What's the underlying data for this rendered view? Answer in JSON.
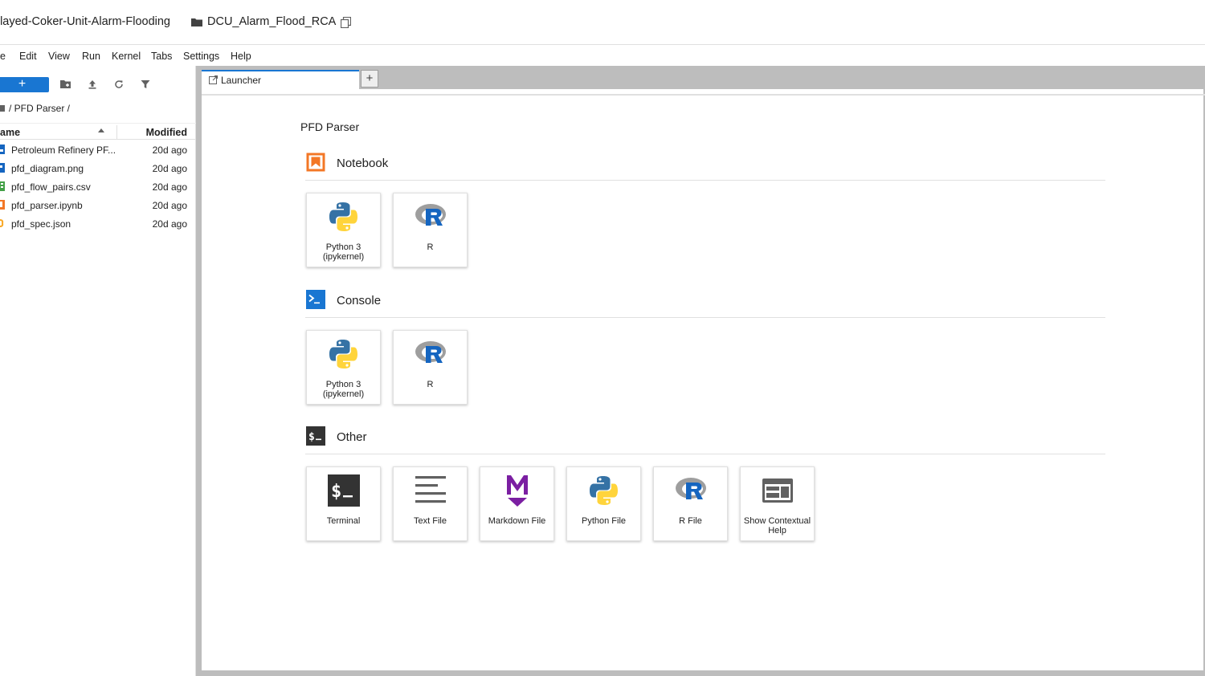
{
  "header": {
    "project_name": "elayed-Coker-Unit-Alarm-Flooding",
    "folder_name": "DCU_Alarm_Flood_RCA"
  },
  "menu": [
    "e",
    "Edit",
    "View",
    "Run",
    "Kernel",
    "Tabs",
    "Settings",
    "Help"
  ],
  "sidebar": {
    "new_button": "+",
    "breadcrumb": "/ PFD Parser /",
    "columns": {
      "name": "ame",
      "modified": "Modified"
    },
    "files": [
      {
        "name": "Petroleum Refinery PF...",
        "modified": "20d ago",
        "icon": "pdf-icon"
      },
      {
        "name": "pfd_diagram.png",
        "modified": "20d ago",
        "icon": "image-icon"
      },
      {
        "name": "pfd_flow_pairs.csv",
        "modified": "20d ago",
        "icon": "spreadsheet-icon"
      },
      {
        "name": "pfd_parser.ipynb",
        "modified": "20d ago",
        "icon": "notebook-icon"
      },
      {
        "name": "pfd_spec.json",
        "modified": "20d ago",
        "icon": "json-icon"
      }
    ]
  },
  "tabs": [
    {
      "label": "Launcher",
      "icon": "launcher-icon"
    }
  ],
  "tab_add": "+",
  "launcher": {
    "title": "PFD Parser",
    "sections": [
      {
        "title": "Notebook",
        "icon": "notebook-icon",
        "cards": [
          {
            "label": "Python 3 (ipykernel)",
            "icon": "python-logo-icon"
          },
          {
            "label": "R",
            "icon": "r-logo-icon"
          }
        ]
      },
      {
        "title": "Console",
        "icon": "console-icon",
        "cards": [
          {
            "label": "Python 3 (ipykernel)",
            "icon": "python-logo-icon"
          },
          {
            "label": "R",
            "icon": "r-logo-icon"
          }
        ]
      },
      {
        "title": "Other",
        "icon": "terminal-icon",
        "cards": [
          {
            "label": "Terminal",
            "icon": "terminal-icon"
          },
          {
            "label": "Text File",
            "icon": "text-file-icon"
          },
          {
            "label": "Markdown File",
            "icon": "markdown-icon"
          },
          {
            "label": "Python File",
            "icon": "python-logo-icon"
          },
          {
            "label": "R File",
            "icon": "r-logo-icon"
          },
          {
            "label": "Show Contextual Help",
            "icon": "contextual-help-icon"
          }
        ]
      }
    ]
  },
  "colors": {
    "accent": "#1976d2",
    "notebook_orange": "#f37726",
    "markdown_purple": "#7b1fa2",
    "python_blue": "#3572a5",
    "python_yellow": "#ffd43b",
    "r_blue": "#1565c0",
    "r_grey": "#9e9e9e",
    "chrome_grey": "#bdbdbd"
  }
}
